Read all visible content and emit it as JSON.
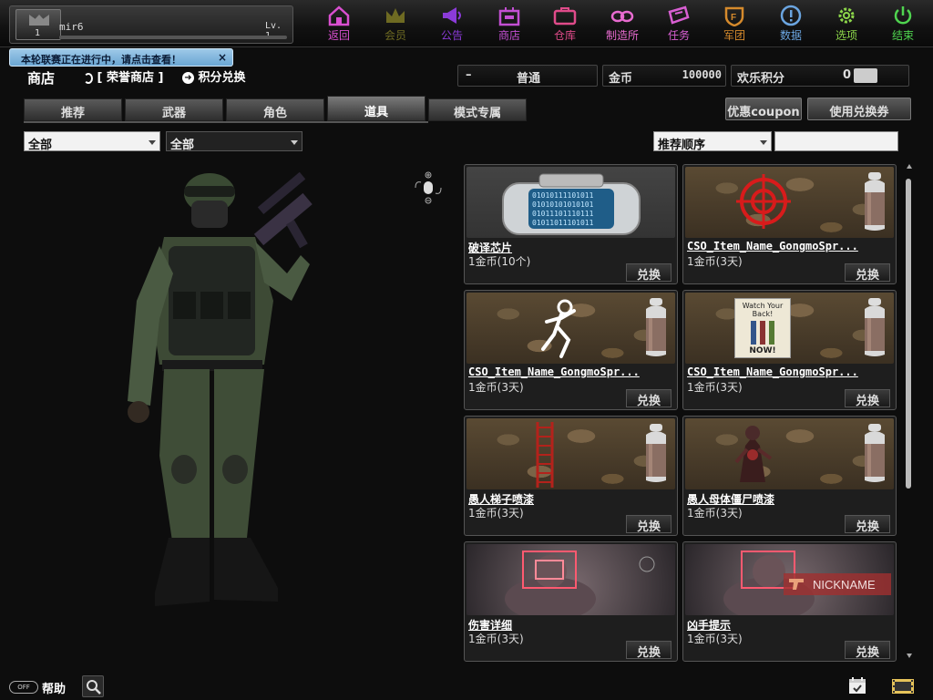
{
  "profile": {
    "name": "mir6",
    "level": "Lv. 1",
    "avatar_num": "1"
  },
  "nav": [
    {
      "key": "back",
      "label": "返回",
      "color": "#d94fd0",
      "icon": "home-icon"
    },
    {
      "key": "vip",
      "label": "会员",
      "color": "#6e6a22",
      "icon": "crown-icon"
    },
    {
      "key": "notice",
      "label": "公告",
      "color": "#8b3bd8",
      "icon": "megaphone-icon"
    },
    {
      "key": "shop",
      "label": "商店",
      "color": "#c34fd3",
      "icon": "shop-icon"
    },
    {
      "key": "storage",
      "label": "仓库",
      "color": "#e04b8a",
      "icon": "briefcase-icon"
    },
    {
      "key": "craft",
      "label": "制造所",
      "color": "#e86bd0",
      "icon": "goggles-icon"
    },
    {
      "key": "mission",
      "label": "任务",
      "color": "#d95fd3",
      "icon": "ticket-icon"
    },
    {
      "key": "clan",
      "label": "军团",
      "color": "#d58a2c",
      "icon": "shield-icon"
    },
    {
      "key": "data",
      "label": "数据",
      "color": "#6ba5e0",
      "icon": "info-icon"
    },
    {
      "key": "options",
      "label": "选项",
      "color": "#8cd64a",
      "icon": "gear-icon"
    },
    {
      "key": "exit",
      "label": "结束",
      "color": "#4fd44f",
      "icon": "power-icon"
    }
  ],
  "tooltip": {
    "text": "本轮联赛正在进行中，请点击查看！",
    "close": "×"
  },
  "header": {
    "title": "商店",
    "honor_shop": "[ 荣誉商店 ]",
    "points_exchange": "积分兑换",
    "mode_dash": "–",
    "mode": "普通",
    "gold_label": "金币",
    "gold_value": "100000",
    "fun_label": "欢乐积分",
    "fun_value": "0"
  },
  "tabs": [
    {
      "label": "推荐",
      "active": false
    },
    {
      "label": "武器",
      "active": false
    },
    {
      "label": "角色",
      "active": false
    },
    {
      "label": "道具",
      "active": true
    },
    {
      "label": "模式专属",
      "active": false
    }
  ],
  "buttons": {
    "coupon": "优惠coupon",
    "use_voucher": "使用兑换券"
  },
  "filters": {
    "filter1": "全部",
    "filter2": "全部",
    "sort": "推荐顺序",
    "search": ""
  },
  "items": [
    {
      "name": "破译芯片",
      "price": "1金币(10个)",
      "button": "兑换",
      "art": "chip",
      "chip_text": [
        "01010111101011",
        "01010101010101",
        "01011101110111",
        "01011011101011"
      ]
    },
    {
      "name": "CSO_Item_Name_GongmoSpr...",
      "price": "1金币(3天)",
      "button": "兑换",
      "art": "target"
    },
    {
      "name": "CSO_Item_Name_GongmoSpr...",
      "price": "1金币(3天)",
      "button": "兑换",
      "art": "runner"
    },
    {
      "name": "CSO_Item_Name_GongmoSpr...",
      "price": "1金币(3天)",
      "button": "兑换",
      "art": "poster",
      "poster_title": "Watch Your Back!",
      "poster_bottom": "NOW!"
    },
    {
      "name": "愚人梯子喷漆",
      "price": "1金币(3天)",
      "button": "兑换",
      "art": "ladder"
    },
    {
      "name": "愚人母体僵尸喷漆",
      "price": "1金币(3天)",
      "button": "兑换",
      "art": "zombie"
    },
    {
      "name": "伤害详细",
      "price": "1金币(3天)",
      "button": "兑换",
      "art": "damage"
    },
    {
      "name": "凶手提示",
      "price": "1金币(3天)",
      "button": "兑换",
      "art": "killer",
      "killer_text": "NICKNAME"
    }
  ],
  "bottom": {
    "help": "帮助",
    "toggle": "OFF"
  }
}
